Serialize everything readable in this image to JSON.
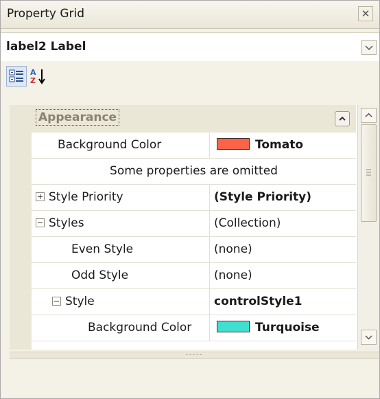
{
  "panel": {
    "title": "Property Grid"
  },
  "selector": {
    "value": "label2  Label"
  },
  "toolbar": {
    "categorized_icon": "categorized-icon",
    "alphabetical_icon": "sort-alphabetical-icon"
  },
  "grid": {
    "category": "Appearance",
    "background_color": {
      "name": "Background Color",
      "value": "Tomato",
      "color": "#ff6347"
    },
    "omitted_note": "Some properties are omitted",
    "style_priority": {
      "name": "Style Priority",
      "value": "(Style Priority)"
    },
    "styles": {
      "name": "Styles",
      "value": "(Collection)"
    },
    "even_style": {
      "name": "Even Style",
      "value": "(none)"
    },
    "odd_style": {
      "name": "Odd Style",
      "value": "(none)"
    },
    "style": {
      "name": "Style",
      "value": "controlStyle1"
    },
    "style_background_color": {
      "name": "Background Color",
      "value": "Turquoise",
      "color": "#40e0d0"
    }
  }
}
